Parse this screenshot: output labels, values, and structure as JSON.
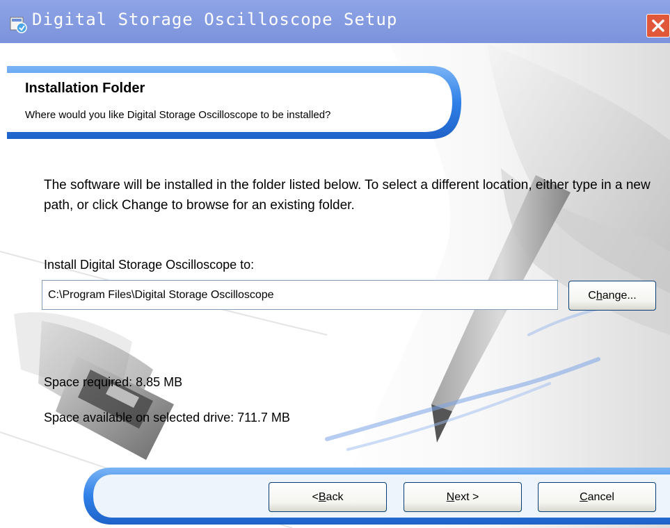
{
  "window": {
    "title": "Digital Storage Oscilloscope Setup"
  },
  "header": {
    "title": "Installation Folder",
    "subtitle": "Where would you like Digital Storage Oscilloscope to be installed?"
  },
  "main": {
    "description": "The software will be installed in the folder listed below. To select a different location, either type in a new path, or click Change to browse for an existing folder.",
    "install_label": "Install Digital Storage Oscilloscope to:",
    "install_path": "C:\\Program Files\\Digital Storage Oscilloscope",
    "change_button": {
      "mnemonic": "",
      "prefix": "C",
      "hot": "h",
      "rest": "ange..."
    },
    "space_required": "Space required: 8.85 MB",
    "space_available": "Space available on selected drive: 711.7 MB"
  },
  "footer": {
    "back_button": {
      "prefix": "< ",
      "hot": "B",
      "rest": "ack"
    },
    "next_button": {
      "prefix": "",
      "hot": "N",
      "rest": "ext >"
    },
    "cancel_button": {
      "prefix": "",
      "hot": "C",
      "rest": "ancel"
    }
  },
  "colors": {
    "titlebar": "#7b93dc",
    "banner_blue": "#2f80e8",
    "close_red": "#e0573a"
  }
}
